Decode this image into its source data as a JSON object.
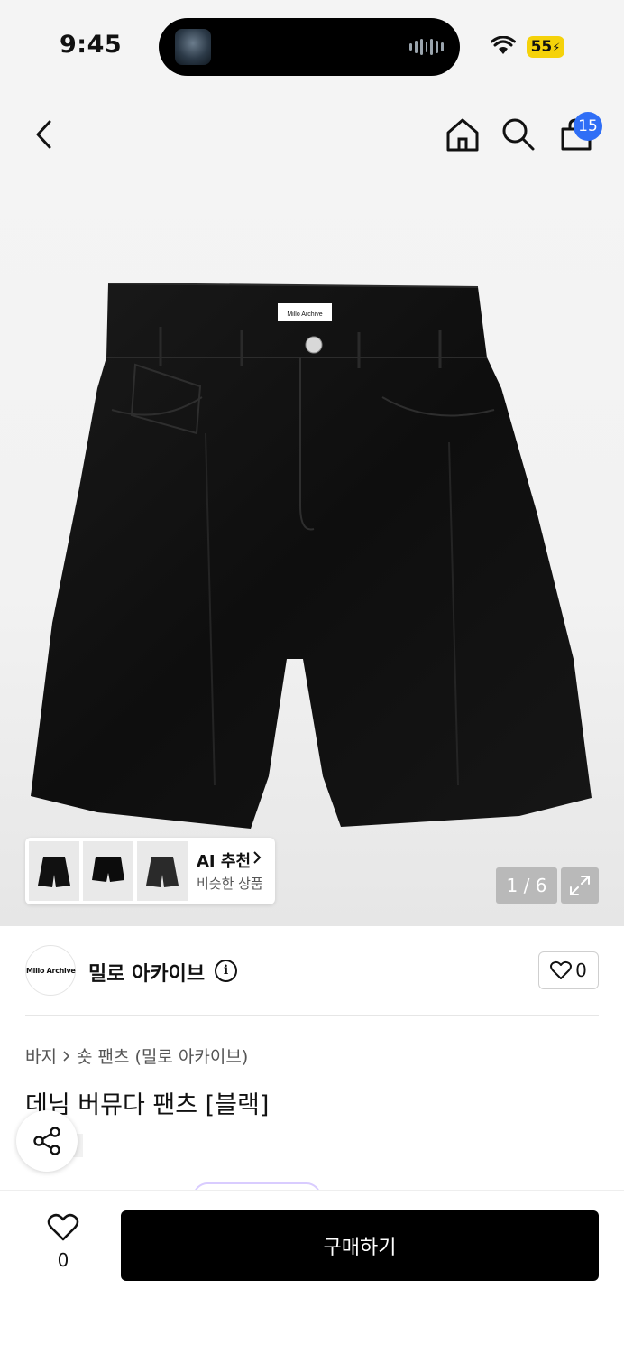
{
  "status_bar": {
    "time": "9:45",
    "battery": "55"
  },
  "nav": {
    "back_icon": "chevron-left-icon",
    "home_icon": "home-icon",
    "search_icon": "search-icon",
    "cart_icon": "shopping-bag-icon",
    "cart_count": "15"
  },
  "product_image": {
    "label_text": "Millo Archive",
    "counter": "1 / 6"
  },
  "ai_recommend": {
    "title": "AI 추천",
    "subtitle": "비슷한 상품"
  },
  "brand": {
    "logo_text": "Millo Archive",
    "name": "밀로 아카이브",
    "like_count": "0"
  },
  "breadcrumb": {
    "category": "바지",
    "subcategory": "숏 팬츠 (밀로 아카이브)"
  },
  "product": {
    "title": "데님 버뮤다 팬츠 [블랙]"
  },
  "bottom": {
    "wish_count": "0",
    "buy_label": "구매하기"
  },
  "colors": {
    "accent": "#2f6ef6",
    "battery": "#f5d20a",
    "button": "#000000"
  }
}
